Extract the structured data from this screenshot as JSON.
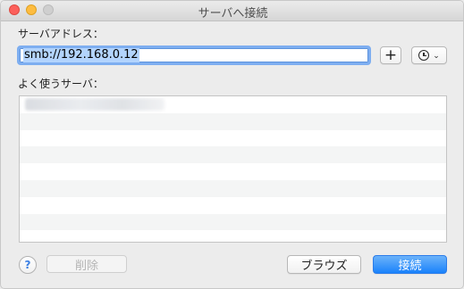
{
  "window": {
    "title": "サーバへ接続"
  },
  "server_address": {
    "label": "サーバアドレス：",
    "value": "smb://192.168.0.12"
  },
  "buttons": {
    "add": "+",
    "recent_chevron": "⌄",
    "delete": "削除",
    "browse": "ブラウズ",
    "connect": "接続",
    "help": "?"
  },
  "favorites": {
    "label": "よく使うサーバ：",
    "rows": 9
  },
  "colors": {
    "accent": "#1a82fb",
    "selection": "#b3d4fd",
    "focus_ring": "#7eaef0"
  },
  "icons": [
    "close-icon",
    "minimize-icon",
    "zoom-icon",
    "plus-icon",
    "clock-icon",
    "chevron-down-icon",
    "help-icon"
  ]
}
